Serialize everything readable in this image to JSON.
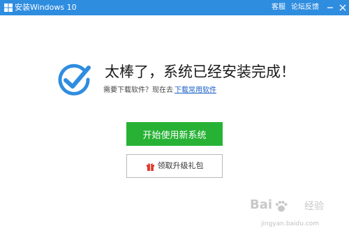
{
  "window": {
    "title": "安装Windows 10",
    "menu": {
      "kefu": "客服",
      "luntan": "论坛反馈"
    },
    "controls": {
      "minimize": "—",
      "close": "✕"
    }
  },
  "main": {
    "headline": "太棒了，系统已经安装完成！",
    "sub_prompt": "需要下载软件？现在去",
    "sub_link": "下载常用软件",
    "primary_button": "开始使用新系统",
    "gift_button": "领取升级礼包"
  },
  "watermark": {
    "logo_a": "Bai",
    "logo_b": "经验",
    "url": "jingyan.baidu.com"
  },
  "colors": {
    "titlebar": "#2f8de0",
    "primary": "#27b235",
    "check": "#2f8de0",
    "gift": "#e23b2e",
    "link": "#1a5fc8"
  },
  "icons": {
    "window": "windows-logo-icon",
    "check": "check-circle-icon",
    "gift": "gift-icon",
    "watermark": "baidu-paw-icon"
  }
}
